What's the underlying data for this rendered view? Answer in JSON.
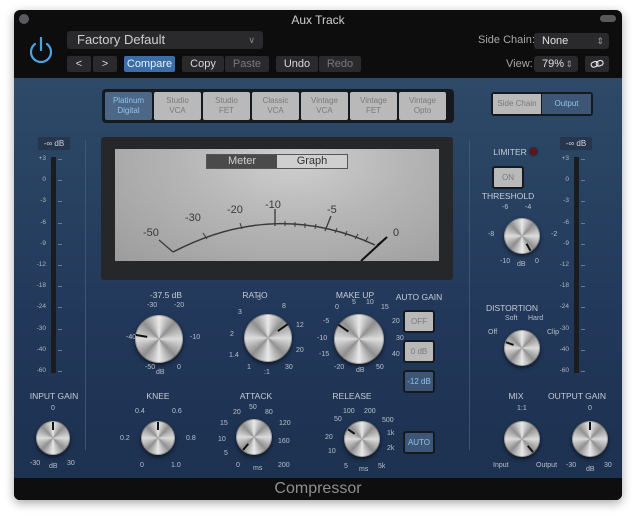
{
  "window": {
    "title": "Aux Track",
    "footer_title": "Compressor"
  },
  "header": {
    "preset": "Factory Default",
    "nav_prev": "<",
    "nav_next": ">",
    "compare": "Compare",
    "copy": "Copy",
    "paste": "Paste",
    "undo": "Undo",
    "redo": "Redo",
    "side_chain_label": "Side Chain:",
    "side_chain_value": "None",
    "view_label": "View:",
    "view_value": "79%",
    "icons": {
      "power": "power-icon",
      "link": "link-icon"
    }
  },
  "modes": [
    {
      "label1": "Platinum",
      "label2": "Digital",
      "active": true
    },
    {
      "label1": "Studio",
      "label2": "VCA",
      "active": false
    },
    {
      "label1": "Studio",
      "label2": "FET",
      "active": false
    },
    {
      "label1": "Classic",
      "label2": "VCA",
      "active": false
    },
    {
      "label1": "Vintage",
      "label2": "VCA",
      "active": false
    },
    {
      "label1": "Vintage",
      "label2": "FET",
      "active": false
    },
    {
      "label1": "Vintage",
      "label2": "Opto",
      "active": false
    }
  ],
  "side_switch": {
    "side_chain": "Side Chain",
    "output": "Output",
    "active": "output"
  },
  "meter": {
    "tabs": {
      "meter": "Meter",
      "graph": "Graph",
      "active": "meter"
    },
    "scale": [
      "-50",
      "-30",
      "-20",
      "-10",
      "-5",
      "0"
    ],
    "needle_value": "0"
  },
  "input_meter": {
    "readout": "-∞ dB",
    "scale": [
      "+3",
      "0",
      "-3",
      "-6",
      "-9",
      "-12",
      "-18",
      "-24",
      "-30",
      "-40",
      "-60"
    ]
  },
  "output_meter": {
    "readout": "-∞ dB",
    "scale": [
      "+3",
      "0",
      "-3",
      "-6",
      "-9",
      "-12",
      "-18",
      "-24",
      "-30",
      "-40",
      "-60"
    ]
  },
  "knobs": {
    "threshold": {
      "label": "-37.5 dB",
      "unit": "dB",
      "ticks": [
        "-30",
        "-20",
        "-40",
        "-10",
        "-50",
        "0"
      ],
      "value_fraction": 0.25
    },
    "ratio": {
      "label": "RATIO",
      "unit": ":1",
      "ticks": [
        "5",
        "3",
        "8",
        "2",
        "12",
        "1.4",
        "20",
        "1",
        "30"
      ],
      "value_fraction": 0.7
    },
    "makeup": {
      "label": "MAKE UP",
      "unit": "dB",
      "ticks": [
        "5",
        "10",
        "0",
        "15",
        "-5",
        "20",
        "-10",
        "30",
        "-15",
        "40",
        "-20",
        "50"
      ],
      "value_fraction": 0.3
    },
    "knee": {
      "label": "KNEE",
      "ticks": [
        "0.4",
        "0.6",
        "0.2",
        "0.8",
        "0",
        "1.0"
      ],
      "value_fraction": 0.5
    },
    "attack": {
      "label": "ATTACK",
      "unit": "ms",
      "ticks": [
        "50",
        "20",
        "80",
        "15",
        "120",
        "10",
        "160",
        "5",
        "200",
        "0"
      ],
      "value_fraction": 0.1
    },
    "release": {
      "label": "RELEASE",
      "unit": "ms",
      "ticks": [
        "100",
        "200",
        "50",
        "500",
        "20",
        "1k",
        "10",
        "2k",
        "5",
        "5k"
      ],
      "value_fraction": 0.3
    },
    "input_gain": {
      "label": "INPUT GAIN",
      "unit": "dB",
      "ticks": [
        "0",
        "-30",
        "30"
      ],
      "value_fraction": 0.5
    },
    "limiter_threshold": {
      "label": "THRESHOLD",
      "unit": "dB",
      "ticks": [
        "-6",
        "-4",
        "-8",
        "-2",
        "-10",
        "0"
      ],
      "value_fraction": 0.9
    },
    "distortion": {
      "label": "DISTORTION",
      "ticks": [
        "Soft",
        "Hard",
        "Off",
        "Clip"
      ],
      "value": "Off"
    },
    "mix": {
      "label": "MIX",
      "ticks": [
        "1:1",
        "Input",
        "Output"
      ],
      "value_fraction": 0.9
    },
    "output_gain": {
      "label": "OUTPUT GAIN",
      "unit": "dB",
      "ticks": [
        "0",
        "-30",
        "30"
      ],
      "value_fraction": 0.5
    }
  },
  "auto_gain": {
    "label": "AUTO GAIN",
    "off": "OFF",
    "zero": "0 dB",
    "minus12": "-12 dB",
    "active": "-12 dB"
  },
  "release_auto": "AUTO",
  "limiter": {
    "label": "LIMITER",
    "button": "ON"
  }
}
